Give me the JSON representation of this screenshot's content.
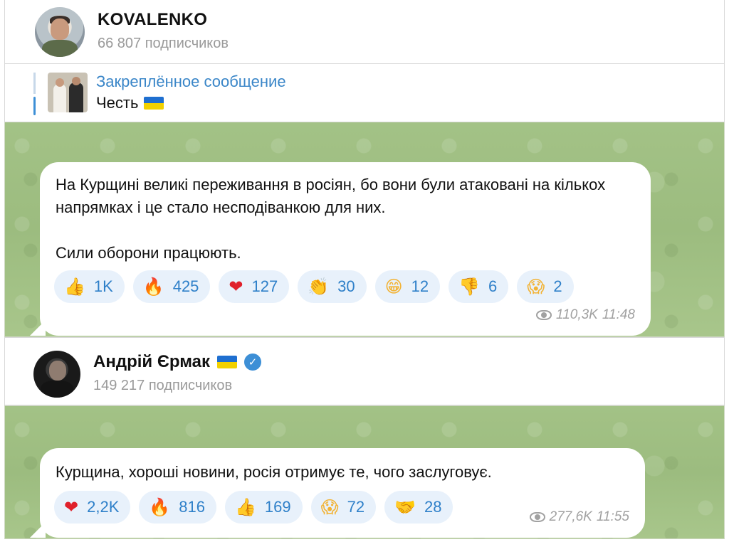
{
  "channel1": {
    "title": "KOVALENKO",
    "subscribers": "66 807 подписчиков",
    "avatar_icon": "person-avatar"
  },
  "pinned": {
    "label": "Закреплённое сообщение",
    "text": "Честь",
    "flag_icon": "ukraine-flag-icon"
  },
  "post1": {
    "text": "На Курщині великі переживання в росіян, бо вони були атаковані на кількох напрямках і це стало несподіванкою для них.\n\nСили оборони працюють.",
    "reactions": [
      {
        "icon": "thumbs-up-icon",
        "glyph": "👍",
        "count": "1K"
      },
      {
        "icon": "fire-icon",
        "glyph": "🔥",
        "count": "425"
      },
      {
        "icon": "heart-icon",
        "glyph": "❤",
        "count": "127"
      },
      {
        "icon": "clapping-hands-icon",
        "glyph": "👏",
        "count": "30"
      },
      {
        "icon": "grinning-face-icon",
        "glyph": "😁",
        "count": "12"
      },
      {
        "icon": "thumbs-down-icon",
        "glyph": "👎",
        "count": "6"
      },
      {
        "icon": "screaming-face-icon",
        "glyph": "😱",
        "count": "2"
      }
    ],
    "views": "110,3K",
    "time": "11:48"
  },
  "channel2": {
    "title": "Андрій Єрмак",
    "subscribers": "149 217 подписчиков",
    "verified_icon": "verified-badge-icon",
    "flag_icon": "ukraine-flag-icon"
  },
  "post2": {
    "text": "Курщина, хороші новини, росія отримує те, чого заслуговує.",
    "reactions": [
      {
        "icon": "heart-icon",
        "glyph": "❤",
        "count": "2,2K"
      },
      {
        "icon": "fire-icon",
        "glyph": "🔥",
        "count": "816"
      },
      {
        "icon": "thumbs-up-icon",
        "glyph": "👍",
        "count": "169"
      },
      {
        "icon": "screaming-face-icon",
        "glyph": "😱",
        "count": "72"
      },
      {
        "icon": "handshake-icon",
        "glyph": "🤝",
        "count": "28"
      }
    ],
    "views": "277,6K",
    "time": "11:55"
  },
  "colors": {
    "accent": "#3a86c8",
    "reaction_bg": "#e8f1fb",
    "chat_bg": "#9fbf82",
    "flag_blue": "#1f6fd0",
    "flag_yellow": "#f2d100"
  }
}
